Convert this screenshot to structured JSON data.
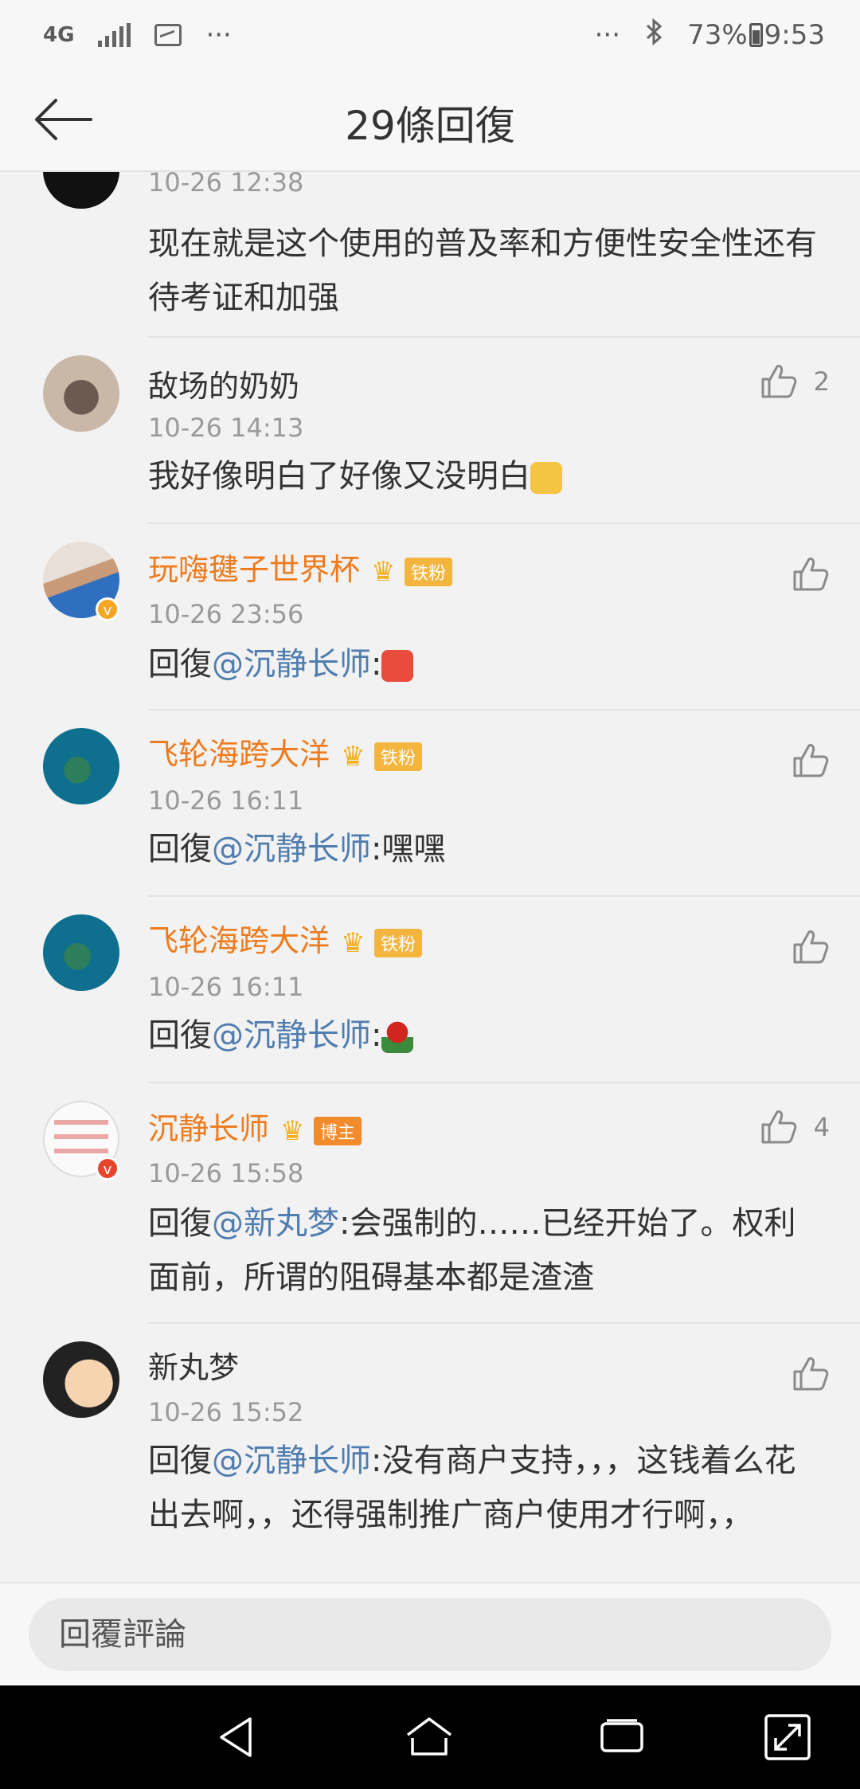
{
  "status_bar": {
    "network": "4G",
    "dots_left": "···",
    "dots_right": "···",
    "battery": "73%",
    "time": "9:53"
  },
  "header": {
    "title": "29條回復"
  },
  "comments": [
    {
      "time": "10-26 12:38",
      "text": "现在就是这个使用的普及率和方便性安全性还有待考证和加强"
    },
    {
      "name": "敌场的奶奶",
      "time": "10-26 14:13",
      "text": "我好像明白了好像又没明白",
      "likes": "2"
    },
    {
      "name": "玩嗨毽子世界杯",
      "badge": "铁粉",
      "time": "10-26 23:56",
      "prefix": "回復",
      "mention": "@沉静长师",
      "suffix": ":"
    },
    {
      "name": "飞轮海跨大洋",
      "badge": "铁粉",
      "time": "10-26 16:11",
      "prefix": "回復",
      "mention": "@沉静长师",
      "suffix": ":嘿嘿"
    },
    {
      "name": "飞轮海跨大洋",
      "badge": "铁粉",
      "time": "10-26 16:11",
      "prefix": "回復",
      "mention": "@沉静长师",
      "suffix": ":"
    },
    {
      "name": "沉静长师",
      "badge": "博主",
      "time": "10-26 15:58",
      "prefix": "回復",
      "mention": "@新丸梦",
      "suffix": ":会强制的……已经开始了。权利面前，所谓的阻碍基本都是渣渣",
      "likes": "4"
    },
    {
      "name": "新丸梦",
      "time": "10-26 15:52",
      "prefix": "回復",
      "mention": "@沉静长师",
      "suffix": ":没有商户支持，，，这钱着么花出去啊，，还得强制推广商户使用才行啊，，"
    }
  ],
  "reply_bar": {
    "placeholder": "回覆評論"
  },
  "icons": {
    "like": "thumbs-up-icon",
    "back": "back-arrow-icon",
    "nav": [
      "nav-back-icon",
      "nav-home-icon",
      "nav-recents-icon",
      "nav-expand-icon"
    ]
  },
  "colors": {
    "name_vip": "#ee7b1d",
    "mention": "#507daf",
    "badge": "#f4b53f"
  }
}
